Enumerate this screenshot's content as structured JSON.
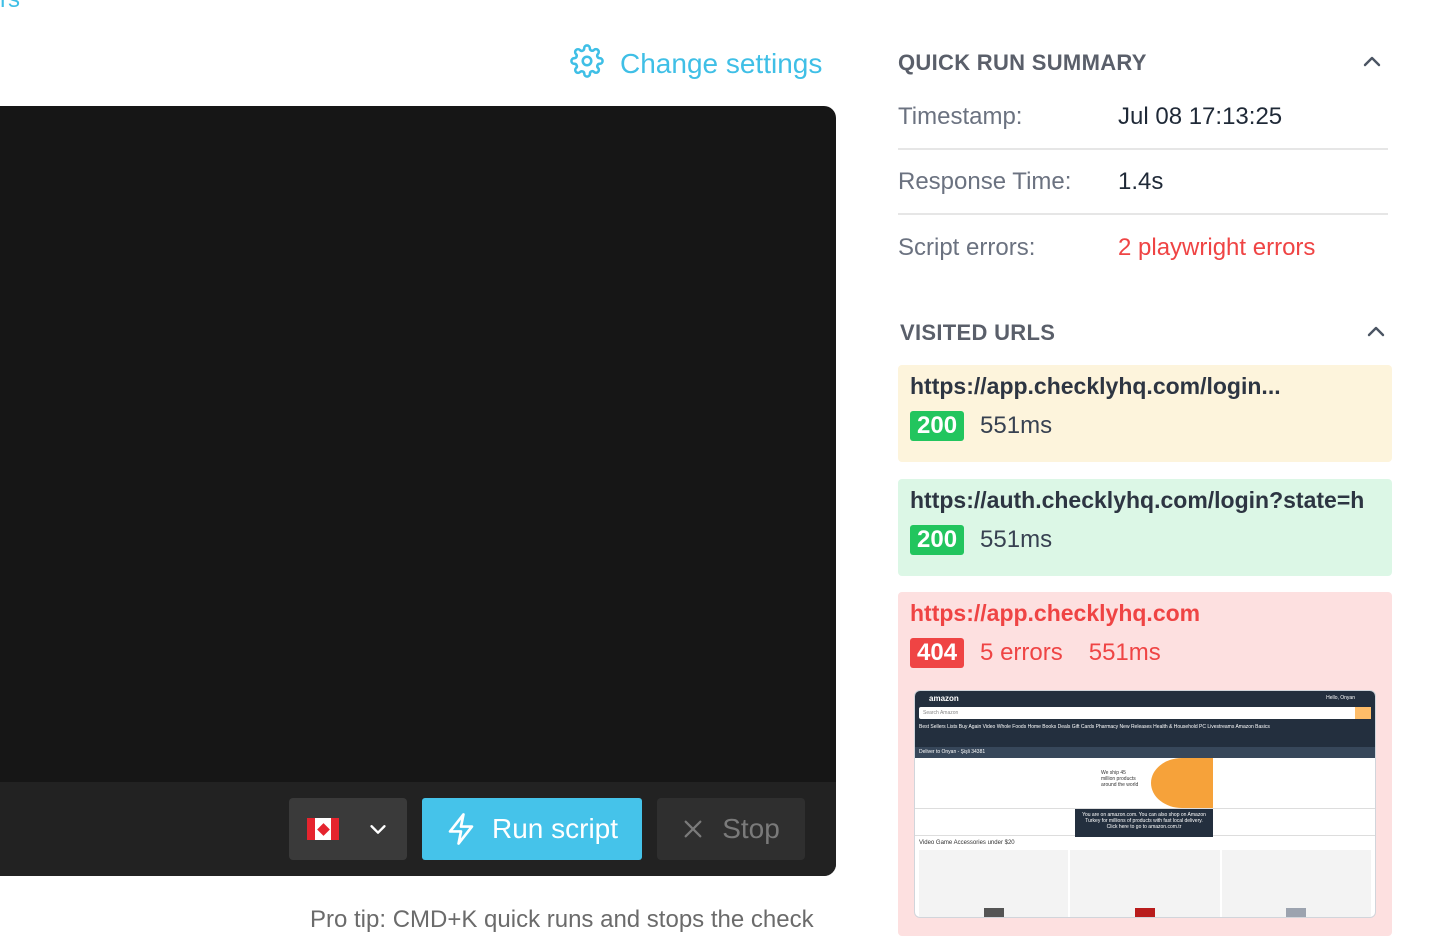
{
  "header": {
    "top_link": "rs",
    "change_settings_label": "Change settings"
  },
  "editor": {
    "country_flag": "Canada",
    "run_label": "Run script",
    "stop_label": "Stop"
  },
  "protip": "Pro tip: CMD+K quick runs and stops the check",
  "summary": {
    "title": "QUICK RUN SUMMARY",
    "rows": [
      {
        "label": "Timestamp:",
        "value": "Jul 08 17:13:25"
      },
      {
        "label": "Response Time:",
        "value": "1.4s"
      },
      {
        "label": "Script errors:",
        "value": "2 playwright errors"
      }
    ]
  },
  "visited": {
    "title": "VISITED URLS",
    "items": [
      {
        "url": "https://app.checklyhq.com/login...",
        "status": "200",
        "time": "551ms",
        "state": "warning"
      },
      {
        "url": "https://auth.checklyhq.com/login?state=h",
        "status": "200",
        "time": "551ms",
        "state": "success"
      },
      {
        "url": "https://app.checklyhq.com",
        "status": "404",
        "errors": "5 errors",
        "time": "551ms",
        "state": "error"
      }
    ]
  },
  "thumbnail": {
    "logo": "amazon",
    "greeting": "Hello, Onyan",
    "search_placeholder": "Search Amazon",
    "nav": "Best Sellers    Lists    Buy Again    Video    Whole Foods    Home    Books    Deals    Gift Cards    Pharmacy    New Releases    Health & Household    PC    Livestreams    Amazon Basics",
    "deliver": "Deliver to Onyan - Şişli 34381",
    "hero_text": "We ship 45 million products around the world",
    "band_text": "You are on amazon.com. You can also shop on Amazon Turkey for millions of products with fast local delivery. Click here to go to amazon.com.tr",
    "section": "Video Game Accessories under $20"
  },
  "colors": {
    "accent": "#45c3ea",
    "success": "#22c55e",
    "error": "#ef4444"
  },
  "icons": [
    "gear-icon",
    "chevron-down-icon",
    "lightning-icon",
    "close-icon",
    "chevron-up-icon"
  ]
}
